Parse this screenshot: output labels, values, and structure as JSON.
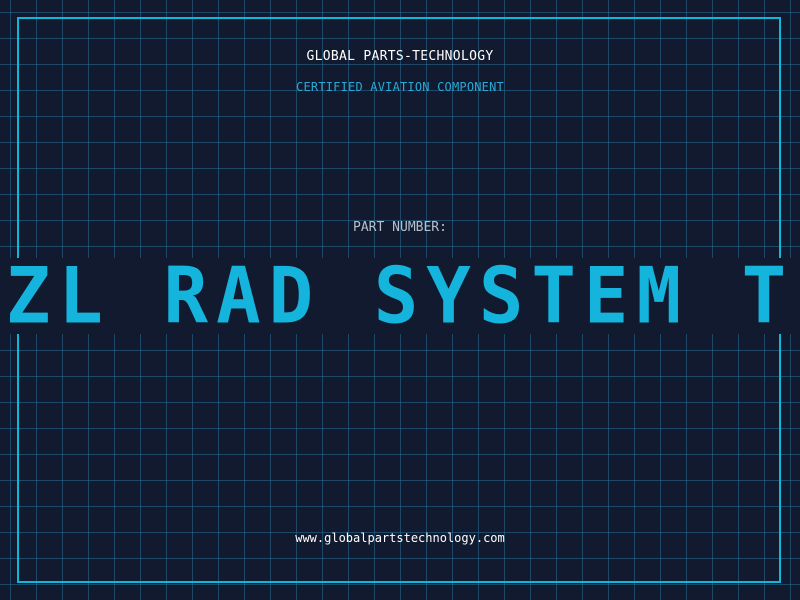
{
  "header": {
    "company": "GLOBAL PARTS-TECHNOLOGY",
    "tagline": "CERTIFIED AVIATION COMPONENT"
  },
  "part": {
    "label": "PART NUMBER:",
    "value": "ETZL RAD SYSTEM TES"
  },
  "footer": {
    "url": "www.globalpartstechnology.com"
  },
  "colors": {
    "background": "#111a2e",
    "grid": "#286e96",
    "accent": "#14b4dc",
    "frame": "#0fb7d8"
  }
}
